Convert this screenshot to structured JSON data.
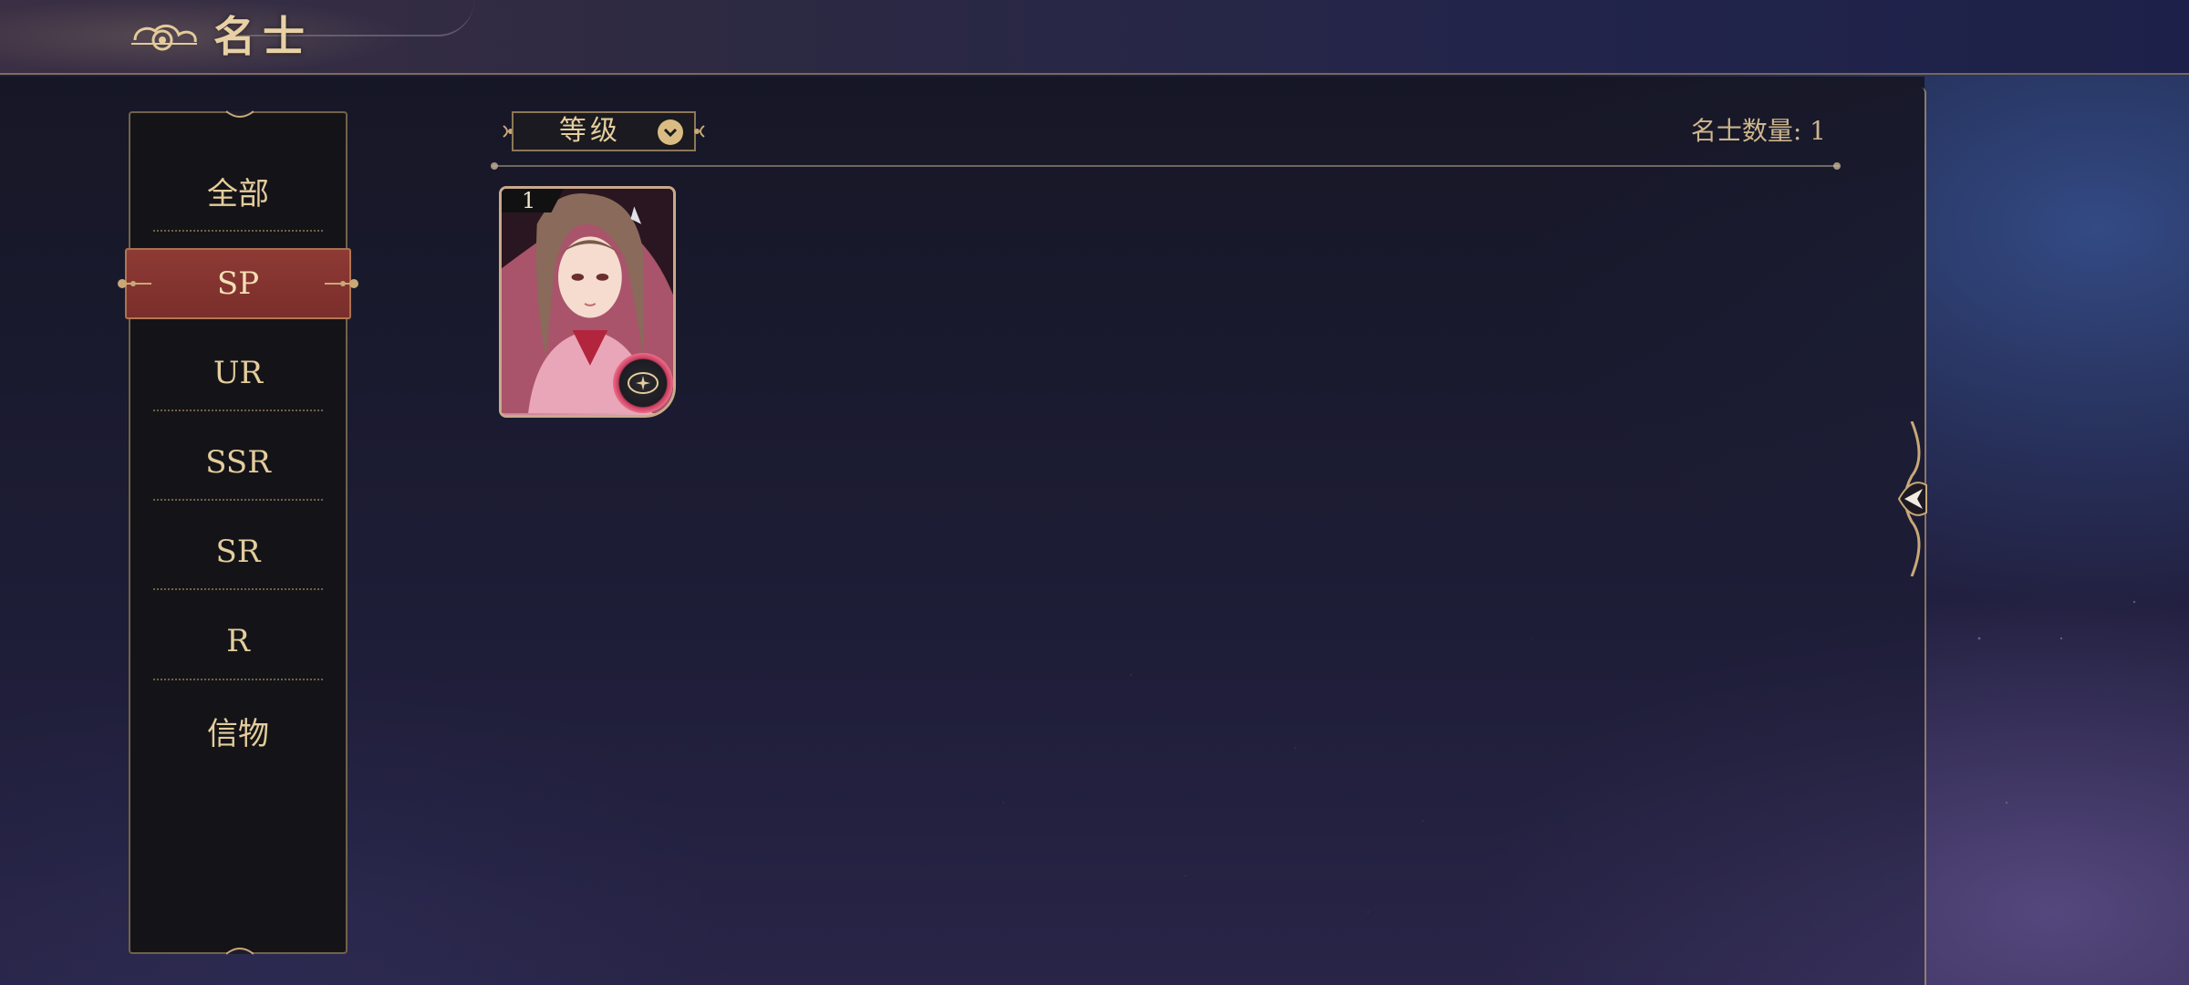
{
  "header": {
    "title": "名士",
    "icon": "cloud-swirl-icon"
  },
  "sidebar": {
    "items": [
      {
        "label": "全部",
        "active": false
      },
      {
        "label": "SP",
        "active": true
      },
      {
        "label": "UR",
        "active": false
      },
      {
        "label": "SSR",
        "active": false
      },
      {
        "label": "SR",
        "active": false
      },
      {
        "label": "R",
        "active": false
      },
      {
        "label": "信物",
        "active": false
      }
    ]
  },
  "toolbar": {
    "sort_label": "等级",
    "sort_icon": "chevron-down-icon",
    "count_text": "名士数量: 1"
  },
  "cards": [
    {
      "level": "1",
      "badge_icon": "compass-badge-icon"
    }
  ],
  "collapse_handle": {
    "icon": "arrow-left-icon"
  },
  "colors": {
    "accent_gold": "#e4cd9c",
    "active_red": "#8e3a34",
    "badge_pink": "#c83b5e",
    "panel_dark": "#141418"
  }
}
